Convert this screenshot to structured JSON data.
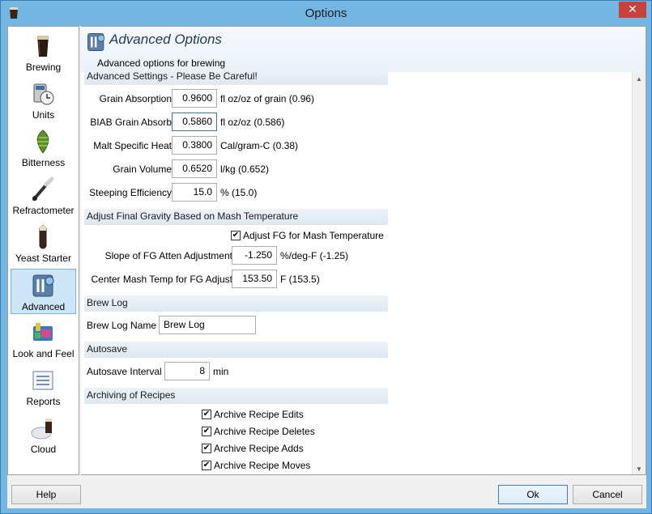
{
  "window": {
    "title": "Options",
    "close_glyph": "✕"
  },
  "sidebar": {
    "items": [
      {
        "label": "Brewing",
        "icon": "beer-glass-icon"
      },
      {
        "label": "Units",
        "icon": "measuring-cup-clock-icon"
      },
      {
        "label": "Bitterness",
        "icon": "hop-cone-icon"
      },
      {
        "label": "Refractometer",
        "icon": "refractometer-icon"
      },
      {
        "label": "Yeast Starter",
        "icon": "test-tube-icon"
      },
      {
        "label": "Advanced",
        "icon": "advanced-gear-icon"
      },
      {
        "label": "Look and Feel",
        "icon": "paint-palette-icon"
      },
      {
        "label": "Reports",
        "icon": "report-checklist-icon"
      },
      {
        "label": "Cloud",
        "icon": "cloud-beer-icon"
      }
    ],
    "selected": "Advanced"
  },
  "header": {
    "title": "Advanced Options",
    "subtitle": "Advanced options for brewing"
  },
  "sections": {
    "advanced": "Advanced Settings - Please Be Careful!",
    "adjust_fg": "Adjust Final Gravity Based on Mash Temperature",
    "brew_log": "Brew Log",
    "autosave": "Autosave",
    "archiving": "Archiving of Recipes"
  },
  "fields": {
    "grain_absorption": {
      "label": "Grain Absorption",
      "value": "0.9600",
      "unit": "fl oz/oz of grain (0.96)"
    },
    "biab_grain_absorb": {
      "label": "BIAB Grain Absorb",
      "value": "0.5860",
      "unit": "fl oz/oz (0.586)"
    },
    "malt_specific_heat": {
      "label": "Malt Specific Heat",
      "value": "0.3800",
      "unit": "Cal/gram-C (0.38)"
    },
    "grain_volume": {
      "label": "Grain Volume",
      "value": "0.6520",
      "unit": "l/kg (0.652)"
    },
    "steeping_efficiency": {
      "label": "Steeping Efficiency",
      "value": "15.0",
      "unit": "% (15.0)"
    },
    "slope_fg": {
      "label": "Slope of FG Atten Adjustment",
      "value": "-1.250",
      "unit": "%/deg-F (-1.25)"
    },
    "center_mash_temp": {
      "label": "Center Mash Temp for FG Adjust",
      "value": "153.50",
      "unit": "F (153.5)"
    },
    "brew_log_name": {
      "label": "Brew Log Name",
      "value": "Brew Log"
    },
    "autosave_interval": {
      "label": "Autosave Interval",
      "value": "8",
      "unit": "min"
    }
  },
  "checkboxes": {
    "adjust_fg": {
      "label": "Adjust FG for Mash Temperature",
      "checked": true
    },
    "archive_edits": {
      "label": "Archive Recipe Edits",
      "checked": true
    },
    "archive_deletes": {
      "label": "Archive Recipe Deletes",
      "checked": true
    },
    "archive_adds": {
      "label": "Archive Recipe Adds",
      "checked": true
    },
    "archive_moves": {
      "label": "Archive Recipe Moves",
      "checked": true
    }
  },
  "check_glyph": "✔",
  "scroll": {
    "up": "▲",
    "down": "▼"
  },
  "buttons": {
    "help": "Help",
    "ok": "Ok",
    "cancel": "Cancel"
  },
  "colors": {
    "titlebar": "#74b6e2",
    "close": "#c7423d",
    "selection": "#cde6f7",
    "section": "#dfe8f1"
  }
}
